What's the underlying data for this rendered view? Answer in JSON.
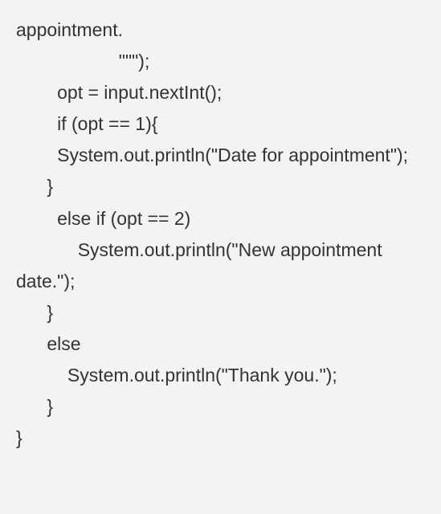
{
  "code": {
    "line1": "appointment.",
    "line2": "                    \"\"\");",
    "line3": "        opt = input.nextInt();",
    "line4": "",
    "line5": "        if (opt == 1){",
    "line6": "        System.out.println(\"Date for appointment\");",
    "line7": "      }",
    "line8": "        else if (opt == 2)",
    "line9": "            System.out.println(\"New appointment date.\");",
    "line10": "      }",
    "line11": "      else",
    "line12": "          System.out.println(\"Thank you.\");",
    "line13": "      }",
    "line14": "}"
  }
}
